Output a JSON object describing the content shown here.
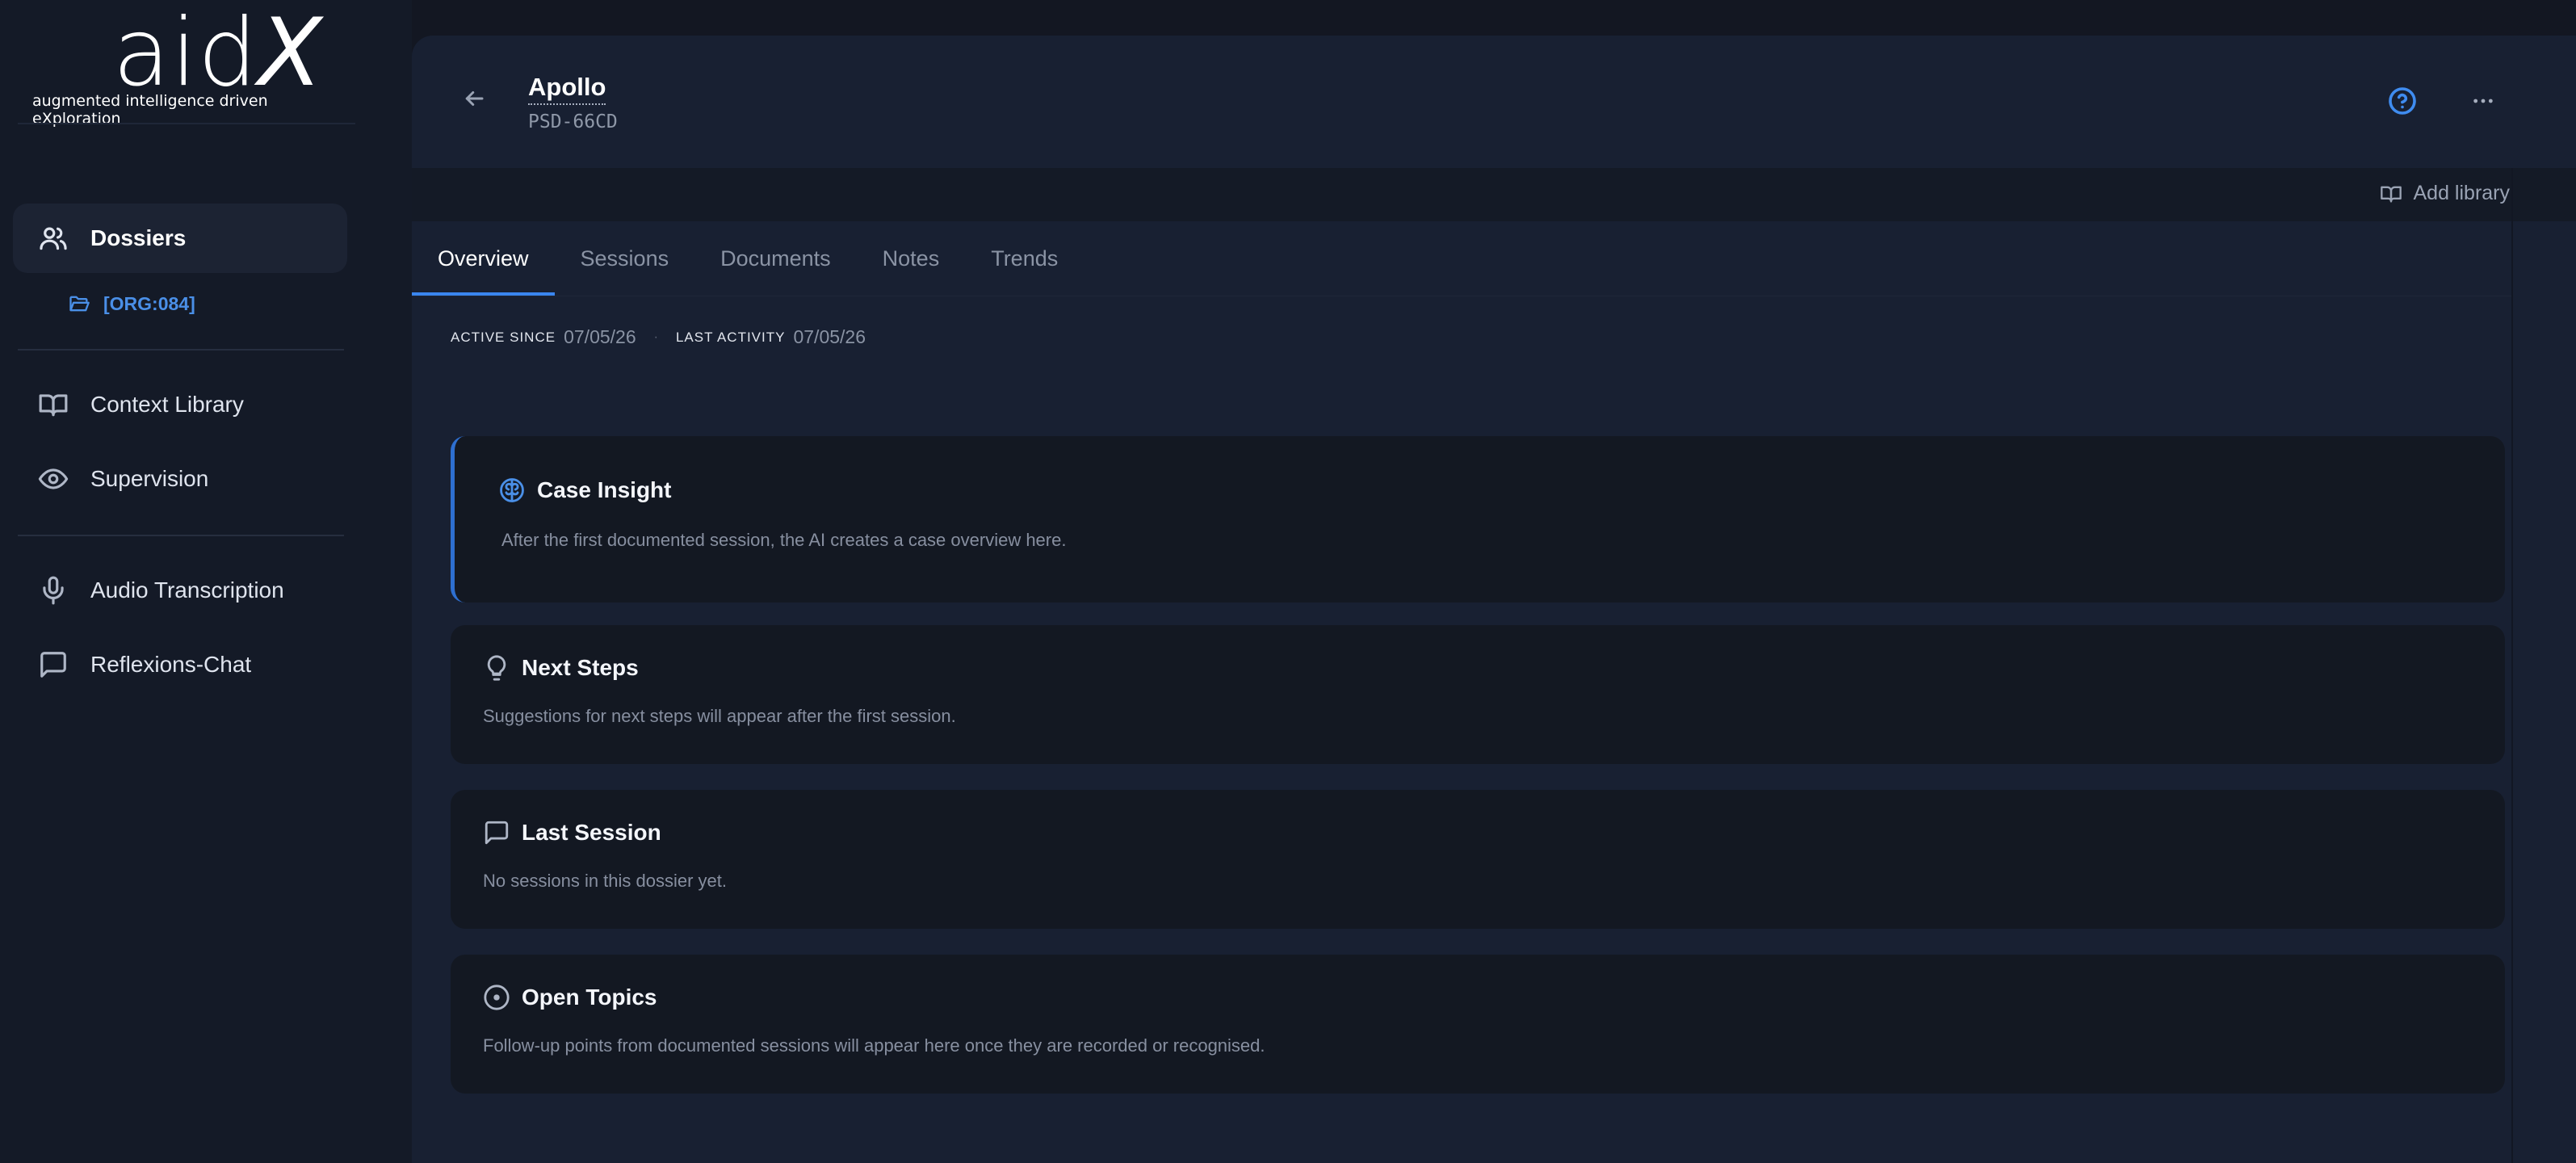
{
  "brand": {
    "word": "aid",
    "word_x": "X",
    "tagline": "augmented intelligence driven eXploration"
  },
  "sidebar": {
    "items": [
      {
        "label": "Dossiers",
        "icon": "users-icon"
      },
      {
        "label": "Context Library",
        "icon": "book-icon"
      },
      {
        "label": "Supervision",
        "icon": "eye-icon"
      },
      {
        "label": "Audio Transcription",
        "icon": "microphone-icon"
      },
      {
        "label": "Reflexions-Chat",
        "icon": "chat-icon"
      }
    ],
    "sub_item": {
      "label": "[ORG:084]",
      "icon": "folder-icon"
    }
  },
  "header": {
    "title": "Apollo",
    "code": "PSD-66CD"
  },
  "toolbar": {
    "add_library_label": "Add library"
  },
  "tabs": [
    {
      "label": "Overview",
      "active": true
    },
    {
      "label": "Sessions",
      "active": false
    },
    {
      "label": "Documents",
      "active": false
    },
    {
      "label": "Notes",
      "active": false
    },
    {
      "label": "Trends",
      "active": false
    }
  ],
  "meta": {
    "active_since_label": "ACTIVE SINCE",
    "active_since_value": "07/05/26",
    "separator": "·",
    "last_activity_label": "LAST ACTIVITY",
    "last_activity_value": "07/05/26"
  },
  "cards": [
    {
      "title": "Case Insight",
      "text": "After the first documented session, the AI creates a case overview here.",
      "icon": "brain-icon"
    },
    {
      "title": "Next Steps",
      "text": "Suggestions for next steps will appear after the first session.",
      "icon": "lightbulb-icon"
    },
    {
      "title": "Last Session",
      "text": "No sessions in this dossier yet.",
      "icon": "chat-icon"
    },
    {
      "title": "Open Topics",
      "text": "Follow-up points from documented sessions will appear here once they are recorded or recognised.",
      "icon": "target-icon"
    }
  ],
  "colors": {
    "accent": "#3a86f0",
    "background": "#131722",
    "sidebar": "#141a27",
    "panel": "#182032",
    "card": "#131822"
  }
}
